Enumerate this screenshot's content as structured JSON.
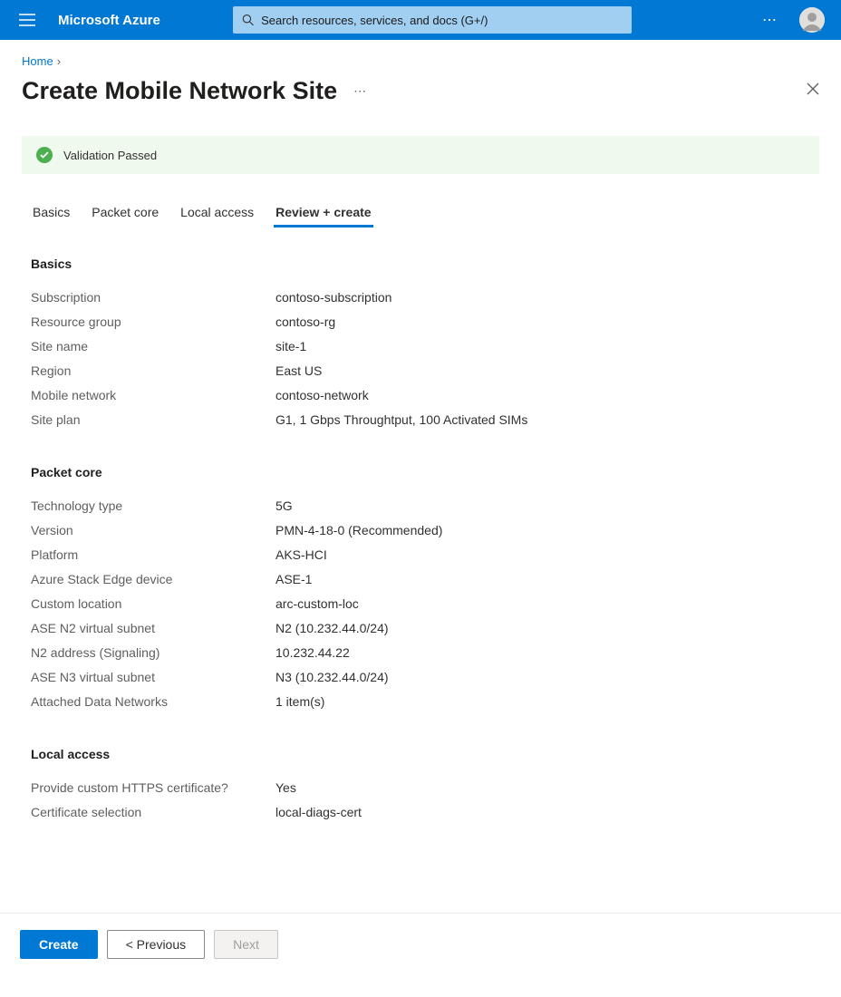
{
  "header": {
    "brand": "Microsoft Azure",
    "search_placeholder": "Search resources, services, and docs (G+/)"
  },
  "breadcrumb": {
    "home": "Home"
  },
  "page": {
    "title": "Create Mobile Network Site"
  },
  "validation": {
    "message": "Validation Passed"
  },
  "tabs": {
    "basics": "Basics",
    "packet_core": "Packet core",
    "local_access": "Local access",
    "review": "Review + create"
  },
  "sections": {
    "basics": {
      "heading": "Basics",
      "rows": [
        {
          "label": "Subscription",
          "value": "contoso-subscription"
        },
        {
          "label": "Resource group",
          "value": "contoso-rg"
        },
        {
          "label": "Site name",
          "value": "site-1"
        },
        {
          "label": "Region",
          "value": "East US"
        },
        {
          "label": "Mobile network",
          "value": "contoso-network"
        },
        {
          "label": "Site plan",
          "value": "G1, 1 Gbps Throughtput, 100 Activated SIMs"
        }
      ]
    },
    "packet_core": {
      "heading": "Packet core",
      "rows": [
        {
          "label": "Technology type",
          "value": "5G"
        },
        {
          "label": "Version",
          "value": "PMN-4-18-0 (Recommended)"
        },
        {
          "label": "Platform",
          "value": "AKS-HCI"
        },
        {
          "label": "Azure Stack Edge device",
          "value": "ASE-1"
        },
        {
          "label": "Custom location",
          "value": "arc-custom-loc"
        },
        {
          "label": "ASE N2 virtual subnet",
          "value": "N2 (10.232.44.0/24)"
        },
        {
          "label": "N2 address (Signaling)",
          "value": "10.232.44.22"
        },
        {
          "label": "ASE N3 virtual subnet",
          "value": "N3 (10.232.44.0/24)"
        },
        {
          "label": "Attached Data Networks",
          "value": "1 item(s)"
        }
      ]
    },
    "local_access": {
      "heading": "Local access",
      "rows": [
        {
          "label": "Provide custom HTTPS certificate?",
          "value": "Yes"
        },
        {
          "label": "Certificate selection",
          "value": "local-diags-cert"
        }
      ]
    }
  },
  "footer": {
    "create": "Create",
    "previous": "< Previous",
    "next": "Next"
  }
}
